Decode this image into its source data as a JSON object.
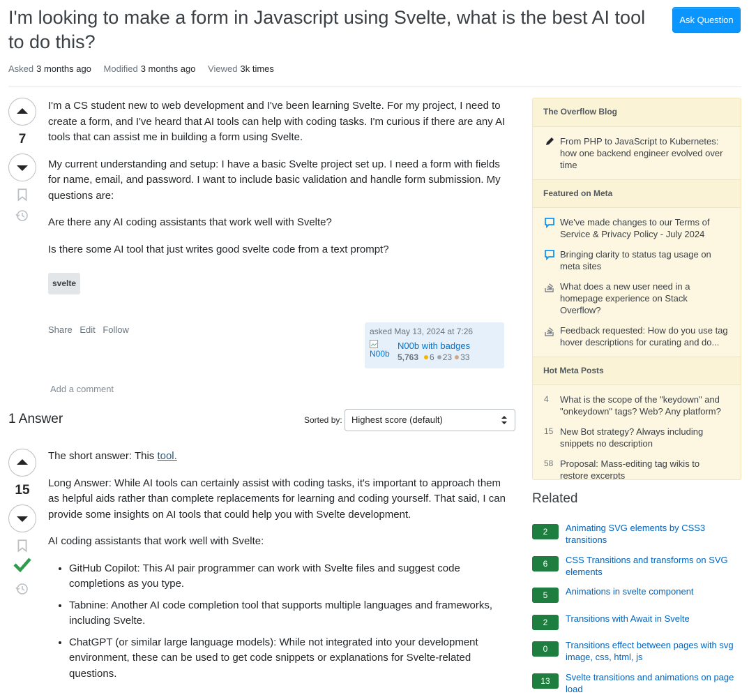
{
  "question": {
    "title": "I'm looking to make a form in Javascript using Svelte, what is the best AI tool to do this?",
    "asked_label": "Asked",
    "asked_value": "3 months ago",
    "modified_label": "Modified",
    "modified_value": "3 months ago",
    "viewed_label": "Viewed",
    "viewed_value": "3k times",
    "votes": "7",
    "paragraphs": [
      "I'm a CS student new to web development and I've been learning Svelte. For my project, I need to create a form, and I've heard that AI tools can help with coding tasks. I'm curious if there are any AI tools that can assist me in building a form using Svelte.",
      "My current understanding and setup: I have a basic Svelte project set up. I need a form with fields for name, email, and password. I want to include basic validation and handle form submission. My questions are:",
      "Are there any AI coding assistants that work well with Svelte?",
      "Is there some AI tool that just writes good svelte code from a text prompt?"
    ],
    "tag": "svelte",
    "menu": {
      "share": "Share",
      "edit": "Edit",
      "follow": "Follow"
    },
    "user": {
      "asked_text": "asked May 13, 2024 at 7:26",
      "avatar_alt": "N00b",
      "name": "N00b with badges",
      "rep": "5,763",
      "gold": "6",
      "silver": "23",
      "bronze": "33"
    },
    "add_comment": "Add a comment"
  },
  "answers_header": "1 Answer",
  "sort": {
    "label": "Sorted by:",
    "value": "Highest score (default)"
  },
  "answer": {
    "votes": "15",
    "short_prefix": "The short answer: This ",
    "short_link": "tool.",
    "long": "Long Answer: While AI tools can certainly assist with coding tasks, it's important to approach them as helpful aids rather than complete replacements for learning and coding yourself. That said, I can provide some insights on AI tools that could help you with Svelte development.",
    "intro": "AI coding assistants that work well with Svelte:",
    "bullets": [
      "GitHub Copilot: This AI pair programmer can work with Svelte files and suggest code completions as you type.",
      "Tabnine: Another AI code completion tool that supports multiple languages and frameworks, including Svelte.",
      "ChatGPT (or similar large language models): While not integrated into your development environment, these can be used to get code snippets or explanations for Svelte-related questions."
    ]
  },
  "ask_button": "Ask Question",
  "sidebar": {
    "blog_header": "The Overflow Blog",
    "blog_items": [
      "From PHP to JavaScript to Kubernetes: how one backend engineer evolved over time"
    ],
    "meta_header": "Featured on Meta",
    "meta_items": [
      "We've made changes to our Terms of Service & Privacy Policy - July 2024",
      "Bringing clarity to status tag usage on meta sites",
      "What does a new user need in a homepage experience on Stack Overflow?",
      "Feedback requested: How do you use tag hover descriptions for curating and do..."
    ],
    "hot_header": "Hot Meta Posts",
    "hot_items": [
      {
        "n": "4",
        "t": "What is the scope of the \"keydown\" and \"onkeydown\" tags? Web? Any platform?"
      },
      {
        "n": "15",
        "t": "New Bot strategy? Always including snippets no description"
      },
      {
        "n": "58",
        "t": "Proposal: Mass-editing tag wikis to restore excerpts"
      }
    ]
  },
  "related": {
    "header": "Related",
    "items": [
      {
        "score": "2",
        "title": "Animating SVG elements by CSS3 transitions"
      },
      {
        "score": "6",
        "title": "CSS Transitions and transforms on SVG elements"
      },
      {
        "score": "5",
        "title": "Animations in svelte component"
      },
      {
        "score": "2",
        "title": "Transitions with Await in Svelte"
      },
      {
        "score": "0",
        "title": "Transitions effect between pages with svg image, css, html, js"
      },
      {
        "score": "13",
        "title": "Svelte transitions and animations on page load"
      }
    ]
  },
  "colors": {
    "accent": "#0a95ff",
    "answered_green": "#1e7e3f",
    "link": "#0063bf",
    "accepted": "#2f9c4e"
  }
}
